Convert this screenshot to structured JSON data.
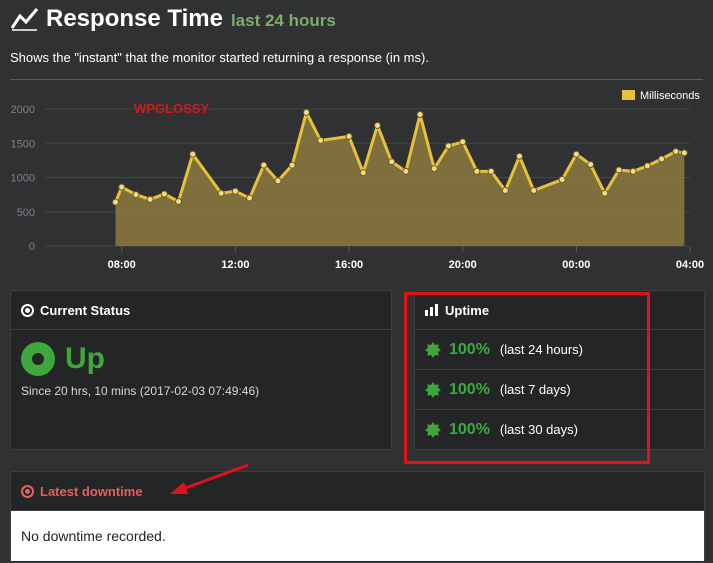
{
  "header": {
    "title": "Response Time",
    "subtitle": "last 24 hours",
    "icon": "trend-line-icon"
  },
  "description": "Shows the \"instant\" that the monitor started returning a response (in ms).",
  "watermark": "WPGLOSSY",
  "colors": {
    "bg": "#2f3133",
    "line": "#e8c13a",
    "fill": "#8c7a3e",
    "green": "#3ea83e",
    "red": "#e0131a"
  },
  "chart_data": {
    "type": "area",
    "legend": "Milliseconds",
    "legend_position": "top-right",
    "y_ticks": [
      "2000",
      "1500",
      "1000",
      "500",
      "0"
    ],
    "x_ticks": [
      "08:00",
      "12:00",
      "16:00",
      "20:00",
      "00:00",
      "04:00"
    ],
    "ylim": [
      0,
      2000
    ],
    "xlim": [
      5.3,
      28
    ],
    "grid": true,
    "series": [
      {
        "name": "Milliseconds",
        "x": [
          7.78,
          8.0,
          8.5,
          9.0,
          9.5,
          10.0,
          10.5,
          11.5,
          12.0,
          12.5,
          13.0,
          13.5,
          14.0,
          14.5,
          15.0,
          16.0,
          16.5,
          17.0,
          17.5,
          18.0,
          18.5,
          19.0,
          19.5,
          20.0,
          20.5,
          21.0,
          21.5,
          22.0,
          22.5,
          23.5,
          24.0,
          24.5,
          25.0,
          25.5,
          26.0,
          26.5,
          27.0,
          27.5,
          27.8
        ],
        "y": [
          640,
          860,
          750,
          680,
          760,
          650,
          1340,
          770,
          800,
          700,
          1180,
          950,
          1180,
          1950,
          1540,
          1600,
          1070,
          1760,
          1230,
          1090,
          1920,
          1130,
          1460,
          1520,
          1090,
          1090,
          810,
          1310,
          810,
          970,
          1340,
          1190,
          770,
          1110,
          1090,
          1170,
          1270,
          1380,
          1360
        ]
      }
    ]
  },
  "status": {
    "title": "Current Status",
    "state": "Up",
    "since": "Since 20 hrs, 10 mins (2017-02-03 07:49:46)"
  },
  "uptime": {
    "title": "Uptime",
    "rows": [
      {
        "pct": "100%",
        "period": "(last 24 hours)"
      },
      {
        "pct": "100%",
        "period": "(last 7 days)"
      },
      {
        "pct": "100%",
        "period": "(last 30 days)"
      }
    ]
  },
  "downtime": {
    "title": "Latest downtime",
    "message": "No downtime recorded."
  }
}
